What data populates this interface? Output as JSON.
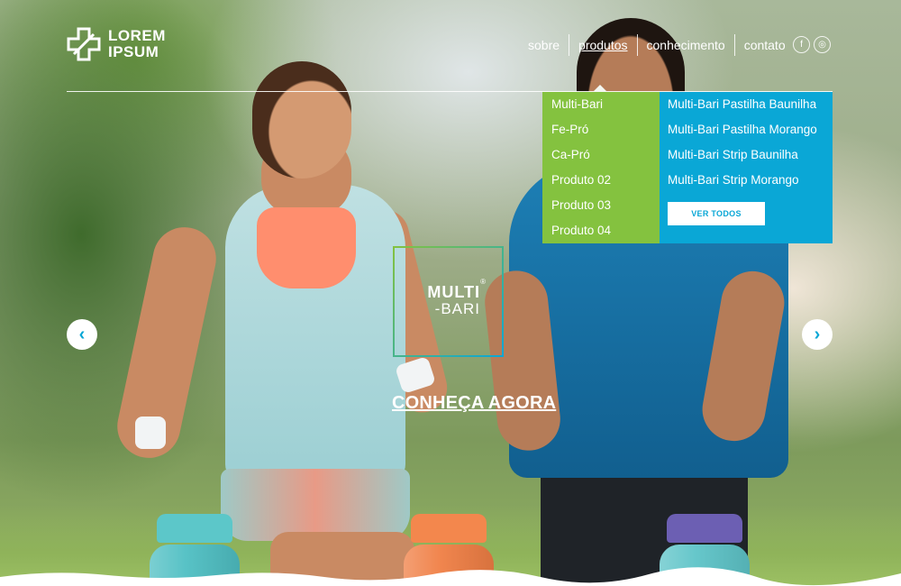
{
  "header": {
    "logo_line1": "LOREM",
    "logo_line2": "IPSUM",
    "nav": [
      "sobre",
      "produtos",
      "conhecimento",
      "contato"
    ],
    "social": {
      "facebook": "f",
      "instagram": "◎"
    }
  },
  "dropdown": {
    "products": [
      "Multi-Bari",
      "Fe-Pró",
      "Ca-Pró",
      "Produto 02",
      "Produto 03",
      "Produto 04"
    ],
    "variants": [
      "Multi-Bari Pastilha Baunilha",
      "Multi-Bari Pastilha Morango",
      "Multi-Bari Strip Baunilha",
      "Multi-Bari Strip Morango"
    ],
    "ver_todos": "VER TODOS"
  },
  "hero": {
    "brand_line1": "MULTI",
    "brand_line2": "-BARI",
    "brand_reg": "®",
    "cta": "CONHEÇA AGORA",
    "arrow_left": "‹",
    "arrow_right": "›"
  },
  "colors": {
    "green": "#84c23f",
    "blue": "#0aa7d6",
    "bottle1": "#4fc0c4",
    "bottle2": "#f0824a",
    "bottle3": "#6b5fb0"
  }
}
